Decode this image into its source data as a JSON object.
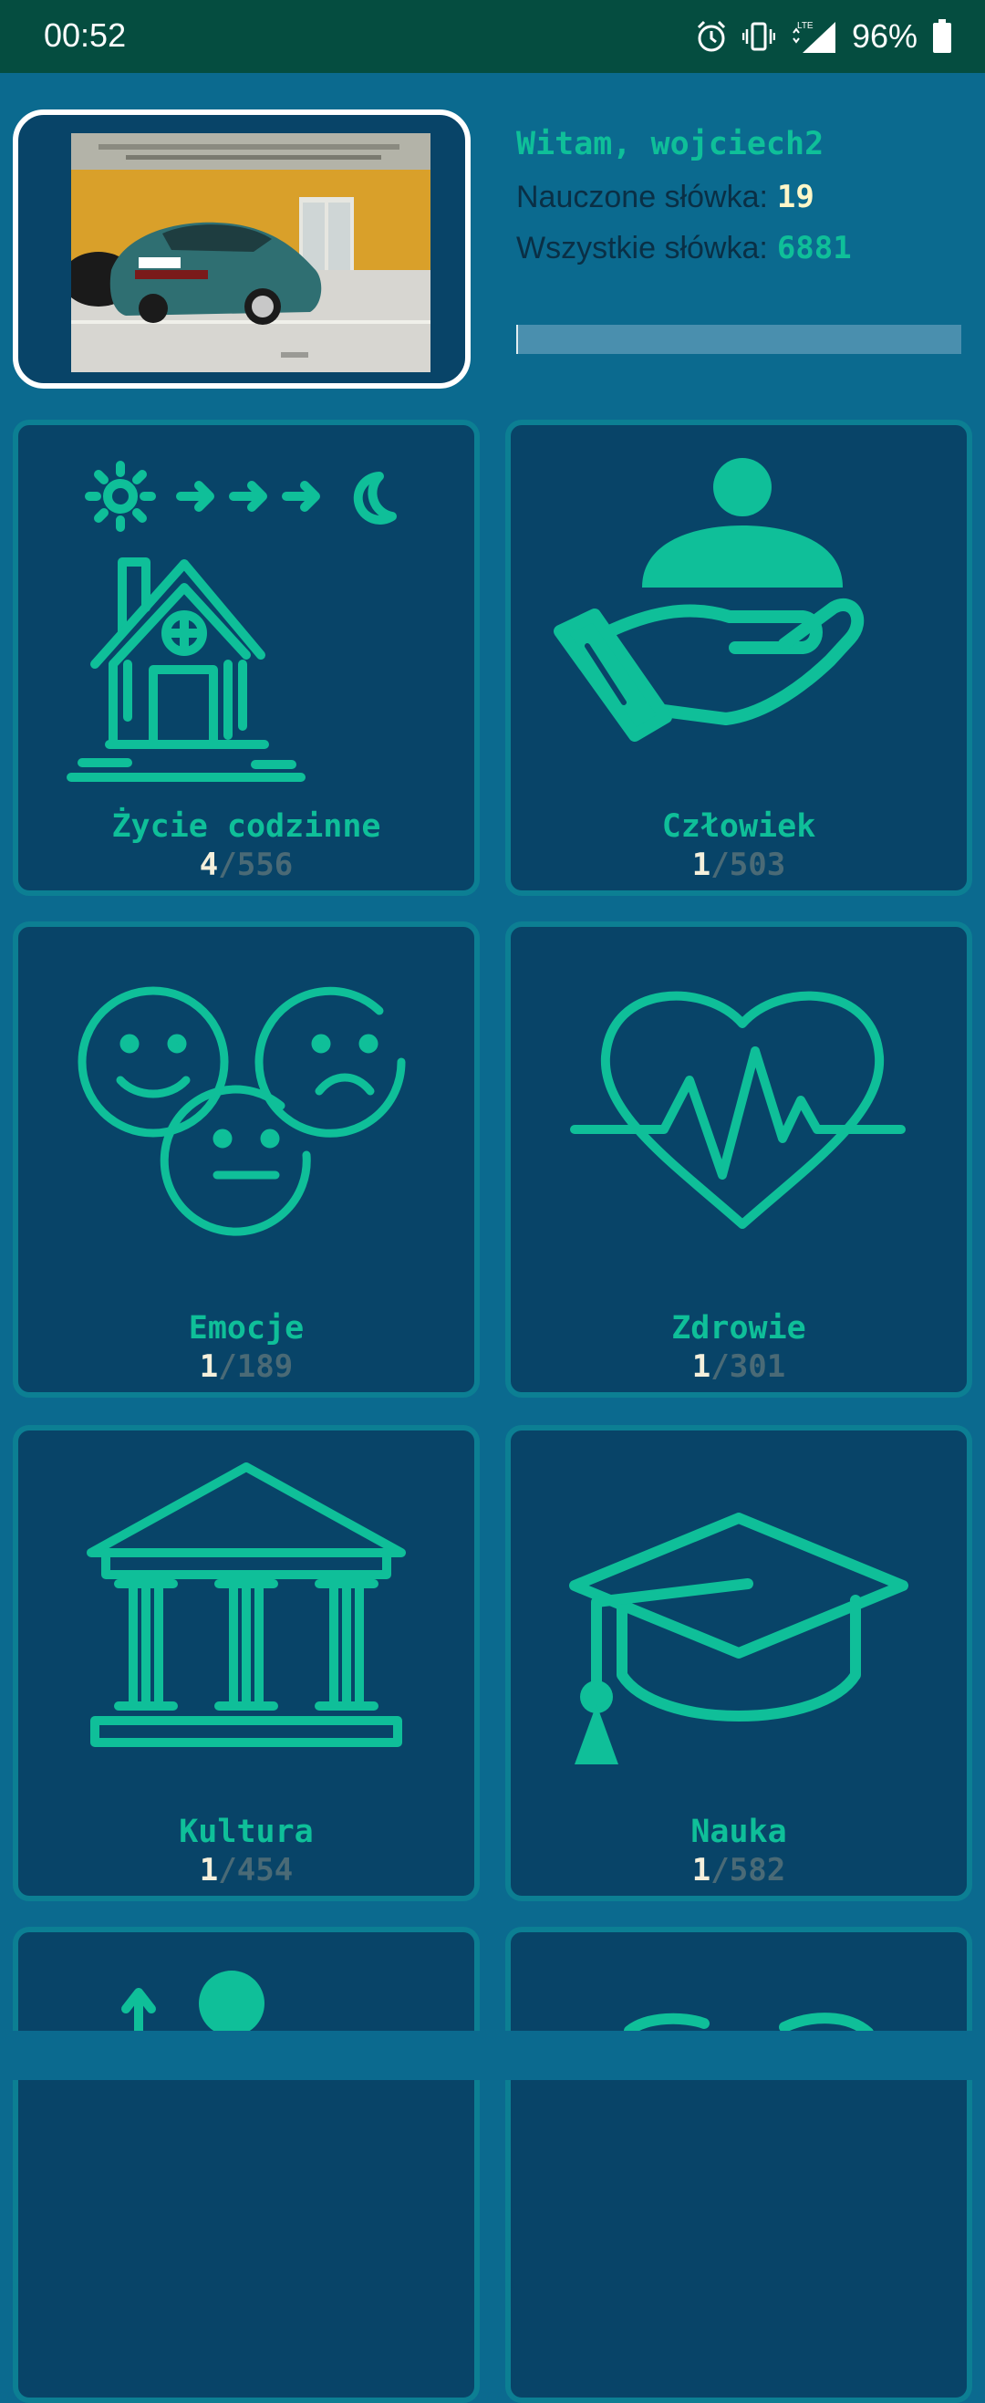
{
  "status_bar": {
    "time": "00:52",
    "battery": "96%",
    "network": "LTE"
  },
  "profile": {
    "greeting": "Witam, wojciech2",
    "learned_label": "Nauczone słówka:",
    "learned_value": "19",
    "all_label": "Wszystkie słówka:",
    "all_value": "6881",
    "progress_fraction": 0.003
  },
  "categories": [
    {
      "title": "Życie codzinne",
      "learned": "4",
      "total": "556",
      "icon": "house-day-icon"
    },
    {
      "title": "Człowiek",
      "learned": "1",
      "total": "503",
      "icon": "person-hand-icon"
    },
    {
      "title": "Emocje",
      "learned": "1",
      "total": "189",
      "icon": "emotions-icon"
    },
    {
      "title": "Zdrowie",
      "learned": "1",
      "total": "301",
      "icon": "heart-pulse-icon"
    },
    {
      "title": "Kultura",
      "learned": "1",
      "total": "454",
      "icon": "temple-icon"
    },
    {
      "title": "Nauka",
      "learned": "1",
      "total": "582",
      "icon": "graduation-cap-icon"
    },
    {
      "title": "",
      "learned": "",
      "total": "",
      "icon": "person-arrow-icon"
    },
    {
      "title": "",
      "learned": "",
      "total": "",
      "icon": "handshake-icon"
    }
  ],
  "separator": "/",
  "colors": {
    "background": "#0b6a8f",
    "tile": "#084468",
    "accent": "#0fbf99",
    "status_bar": "#054d40"
  }
}
